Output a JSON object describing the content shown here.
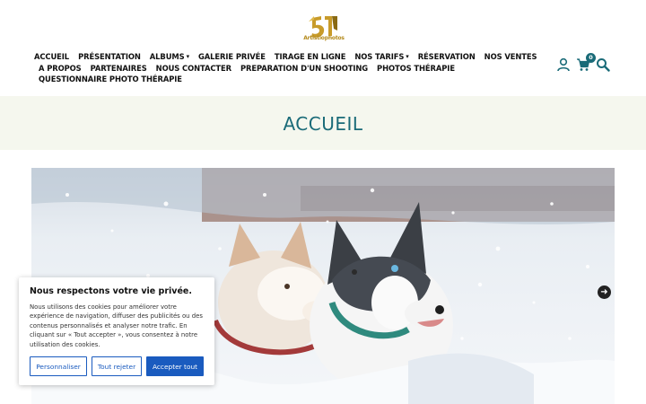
{
  "logo": {
    "text": "Artistiophotos"
  },
  "nav": {
    "row1": [
      {
        "label": "ACCUEIL",
        "dropdown": false
      },
      {
        "label": "PRÉSENTATION",
        "dropdown": false
      },
      {
        "label": "ALBUMS",
        "dropdown": true
      },
      {
        "label": "GALERIE PRIVÉE",
        "dropdown": false
      },
      {
        "label": "TIRAGE EN LIGNE",
        "dropdown": false
      },
      {
        "label": "NOS TARIFS",
        "dropdown": true
      },
      {
        "label": "RÉSERVATION",
        "dropdown": false
      },
      {
        "label": "NOS VENTES",
        "dropdown": false
      }
    ],
    "row2": [
      {
        "label": "A PROPOS"
      },
      {
        "label": "PARTENAIRES"
      },
      {
        "label": "NOUS CONTACTER"
      },
      {
        "label": "PREPARATION D'UN SHOOTING"
      },
      {
        "label": "PHOTOS THÉRAPIE"
      }
    ],
    "row3": [
      {
        "label": "QUESTIONNAIRE PHOTO THÉRAPIE"
      }
    ]
  },
  "header": {
    "cart_count": "0"
  },
  "page": {
    "title": "ACCUEIL"
  },
  "cookie": {
    "title": "Nous respectons votre vie privée.",
    "text": "Nous utilisons des cookies pour améliorer votre expérience de navigation, diffuser des publicités ou des contenus personnalisés et analyser notre trafic. En cliquant sur « Tout accepter », vous consentez à notre utilisation des cookies.",
    "btn_customize": "Personnaliser",
    "btn_reject": "Tout rejeter",
    "btn_accept": "Accepter tout"
  },
  "colors": {
    "accent": "#1a6b78",
    "cookie_button": "#1a5bbf",
    "logo": "#b48a1c"
  }
}
